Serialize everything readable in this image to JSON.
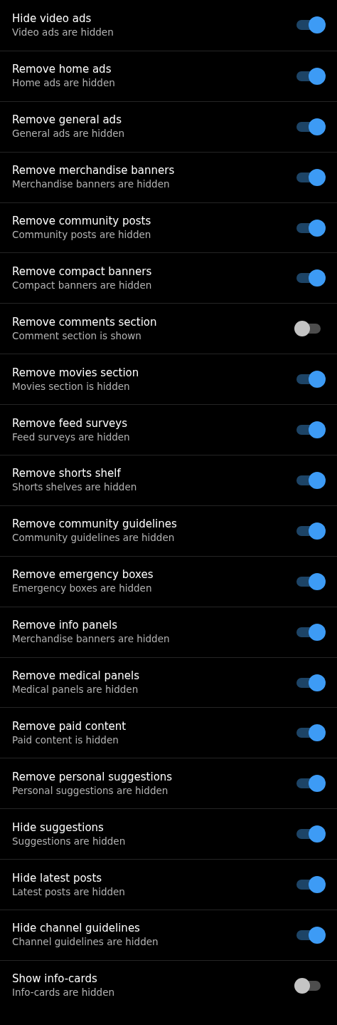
{
  "settings": [
    {
      "title": "Hide video ads",
      "subtitle": "Video ads are hidden",
      "on": true
    },
    {
      "title": "Remove home ads",
      "subtitle": "Home ads are hidden",
      "on": true
    },
    {
      "title": "Remove general ads",
      "subtitle": "General ads are hidden",
      "on": true
    },
    {
      "title": "Remove merchandise banners",
      "subtitle": "Merchandise banners are hidden",
      "on": true
    },
    {
      "title": "Remove community posts",
      "subtitle": "Community posts are hidden",
      "on": true
    },
    {
      "title": "Remove compact banners",
      "subtitle": "Compact banners are hidden",
      "on": true
    },
    {
      "title": "Remove comments section",
      "subtitle": "Comment section is shown",
      "on": false
    },
    {
      "title": "Remove movies section",
      "subtitle": "Movies section is hidden",
      "on": true
    },
    {
      "title": "Remove feed surveys",
      "subtitle": "Feed surveys are hidden",
      "on": true
    },
    {
      "title": "Remove shorts shelf",
      "subtitle": "Shorts shelves are hidden",
      "on": true
    },
    {
      "title": "Remove community guidelines",
      "subtitle": "Community guidelines are hidden",
      "on": true
    },
    {
      "title": "Remove emergency boxes",
      "subtitle": "Emergency boxes are hidden",
      "on": true
    },
    {
      "title": "Remove info panels",
      "subtitle": "Merchandise banners are hidden",
      "on": true
    },
    {
      "title": "Remove medical panels",
      "subtitle": "Medical panels are hidden",
      "on": true
    },
    {
      "title": "Remove paid content",
      "subtitle": "Paid content is hidden",
      "on": true
    },
    {
      "title": "Remove personal suggestions",
      "subtitle": "Personal suggestions are hidden",
      "on": true
    },
    {
      "title": "Hide suggestions",
      "subtitle": "Suggestions are hidden",
      "on": true
    },
    {
      "title": "Hide latest posts",
      "subtitle": "Latest posts are hidden",
      "on": true
    },
    {
      "title": "Hide channel guidelines",
      "subtitle": "Channel guidelines are hidden",
      "on": true
    },
    {
      "title": "Show info-cards",
      "subtitle": "Info-cards are hidden",
      "on": false
    }
  ]
}
